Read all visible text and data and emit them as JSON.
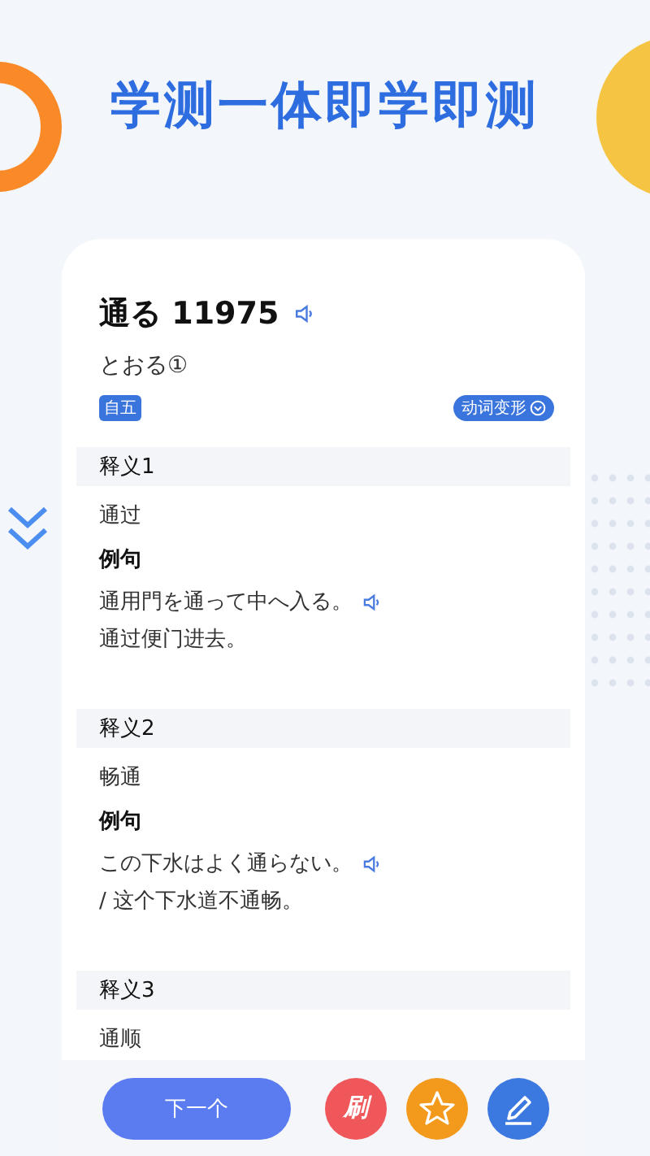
{
  "headline": "学测一体即学即测",
  "word": {
    "title": "通る 11975",
    "reading": "とおる①",
    "pos_tag": "自五",
    "conjugation_button": "动词变形"
  },
  "senses": [
    {
      "label": "释义1",
      "meaning": "通过",
      "example_label": "例句",
      "example": "通用門を通って中へ入る。",
      "translation": "通过便门进去。"
    },
    {
      "label": "释义2",
      "meaning": "畅通",
      "example_label": "例句",
      "example": "この下水はよく通らない。",
      "translation": "/ 这个下水道不通畅。"
    },
    {
      "label": "释义3",
      "meaning": "通顺"
    }
  ],
  "next_button": "下一个",
  "actions": [
    {
      "kind": "text",
      "label": "刷",
      "color": "#f0575a"
    },
    {
      "kind": "star",
      "color": "#f39a1c"
    },
    {
      "kind": "pen",
      "color": "#3b78e0"
    }
  ]
}
